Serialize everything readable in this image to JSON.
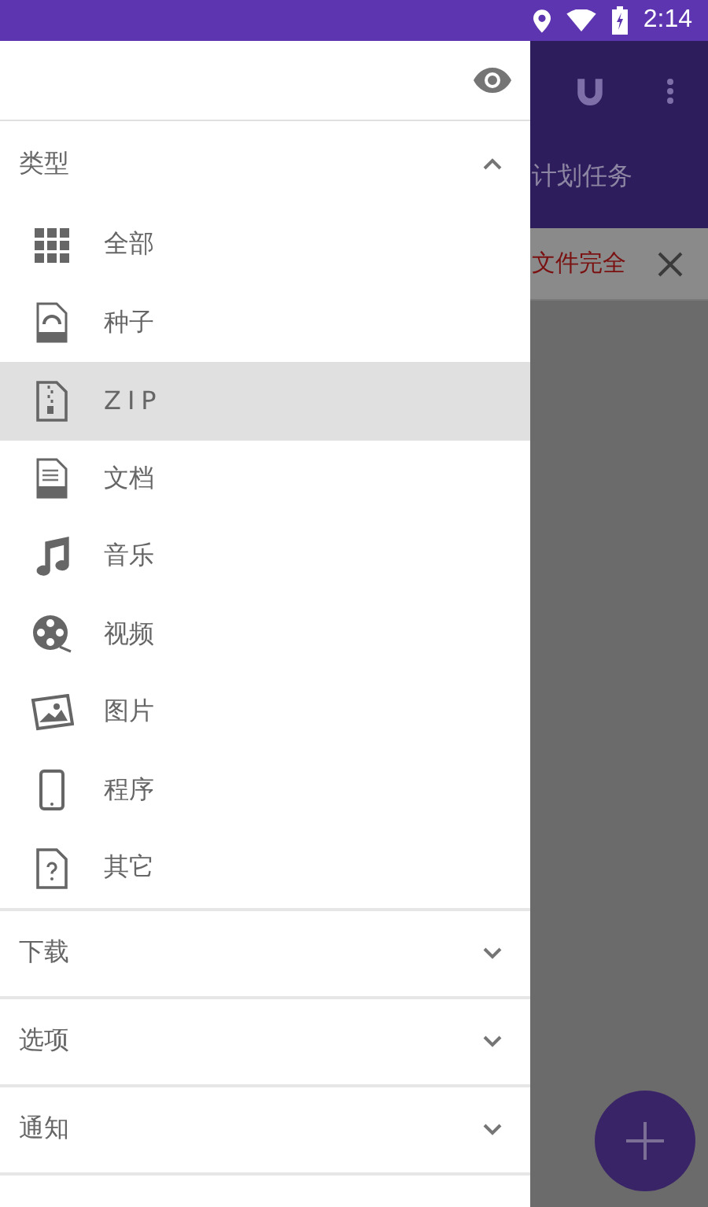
{
  "status_bar": {
    "time": "2:14"
  },
  "background_app": {
    "tab": "计划任务",
    "banner": "文件完全"
  },
  "drawer": {
    "sections": [
      {
        "title": "类型",
        "expanded": true,
        "items": [
          {
            "label": "全部",
            "kind": "all",
            "selected": false
          },
          {
            "label": "种子",
            "kind": "torrent",
            "selected": false
          },
          {
            "label": "ZIP",
            "kind": "zip",
            "selected": true
          },
          {
            "label": "文档",
            "kind": "doc",
            "selected": false
          },
          {
            "label": "音乐",
            "kind": "music",
            "selected": false
          },
          {
            "label": "视频",
            "kind": "video",
            "selected": false
          },
          {
            "label": "图片",
            "kind": "image",
            "selected": false
          },
          {
            "label": "程序",
            "kind": "app",
            "selected": false
          },
          {
            "label": "其它",
            "kind": "other",
            "selected": false
          }
        ]
      },
      {
        "title": "下载",
        "expanded": false
      },
      {
        "title": "选项",
        "expanded": false
      },
      {
        "title": "通知",
        "expanded": false
      }
    ]
  }
}
